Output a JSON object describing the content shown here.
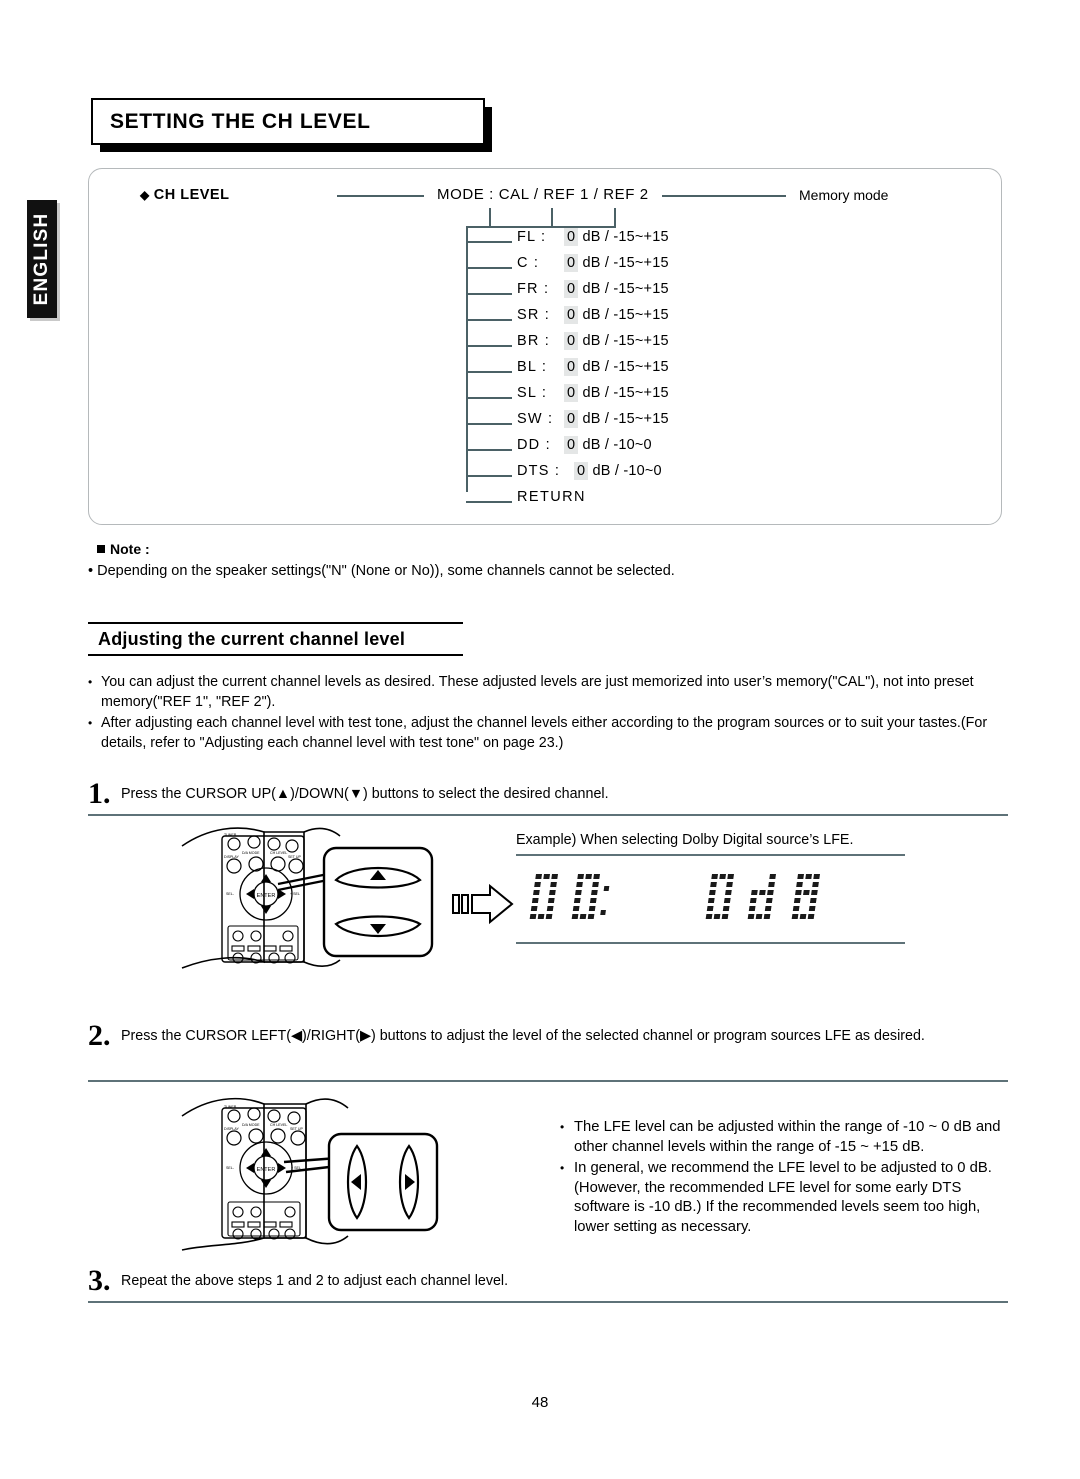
{
  "page": {
    "language_tab": "ENGLISH",
    "title": "SETTING THE CH LEVEL",
    "page_number": "48"
  },
  "diagram": {
    "root_label": "CH LEVEL",
    "root_marker": "◆",
    "mode_text": "MODE :  CAL / REF 1 / REF 2",
    "memory_label": "Memory mode",
    "channels": [
      {
        "name": "FL :",
        "value": "0",
        "unit": "dB / -15~+15"
      },
      {
        "name": "C :",
        "value": "0",
        "unit": "dB / -15~+15"
      },
      {
        "name": "FR :",
        "value": "0",
        "unit": "dB / -15~+15"
      },
      {
        "name": "SR :",
        "value": "0",
        "unit": "dB / -15~+15"
      },
      {
        "name": "BR :",
        "value": "0",
        "unit": "dB / -15~+15"
      },
      {
        "name": "BL :",
        "value": "0",
        "unit": "dB / -15~+15"
      },
      {
        "name": "SL :",
        "value": "0",
        "unit": "dB / -15~+15"
      },
      {
        "name": "SW :",
        "value": "0",
        "unit": "dB / -15~+15"
      },
      {
        "name": "DD :",
        "value": "0",
        "unit": "dB / -10~0"
      },
      {
        "name": "DTS :",
        "value": "0",
        "unit": "dB / -10~0"
      }
    ],
    "return_label": "RETURN"
  },
  "note": {
    "heading": "Note :",
    "text": "Depending on the speaker settings(\"N\" (None or No)), some channels cannot be selected."
  },
  "section": {
    "heading": "Adjusting the current channel level",
    "intro_bullets": [
      "You can adjust the current channel levels as desired. These adjusted levels are just memorized into user’s memory(\"CAL\"), not into preset memory(\"REF 1\", \"REF 2\").",
      "After adjusting each channel level with test tone, adjust the channel levels either according to the program sources or to suit your tastes.(For details, refer to \"Adjusting each channel level with test tone\" on page 23.)"
    ]
  },
  "steps": [
    {
      "num": "1",
      "text": "Press the CURSOR UP(▲)/DOWN(▼) buttons to select the desired channel."
    },
    {
      "num": "2",
      "text": "Press the CURSOR LEFT(◀)/RIGHT(▶) buttons to adjust the level of the selected channel or program sources LFE as desired."
    },
    {
      "num": "3",
      "text": "Repeat the above steps 1 and 2 to adjust each channel level."
    }
  ],
  "example": {
    "caption": "Example) When selecting Dolby Digital source’s LFE.",
    "display_left": "DD:",
    "display_right": "0dB"
  },
  "step2_bullets": [
    "The LFE level can be adjusted within the range of -10 ~ 0 dB and other channel levels within the range of -15 ~ +15 dB.",
    "In general, we recommend the LFE level to be adjusted to 0 dB.(However, the recommended LFE level for some early DTS software is -10 dB.) If the recommended levels seem too high, lower setting as necessary."
  ]
}
